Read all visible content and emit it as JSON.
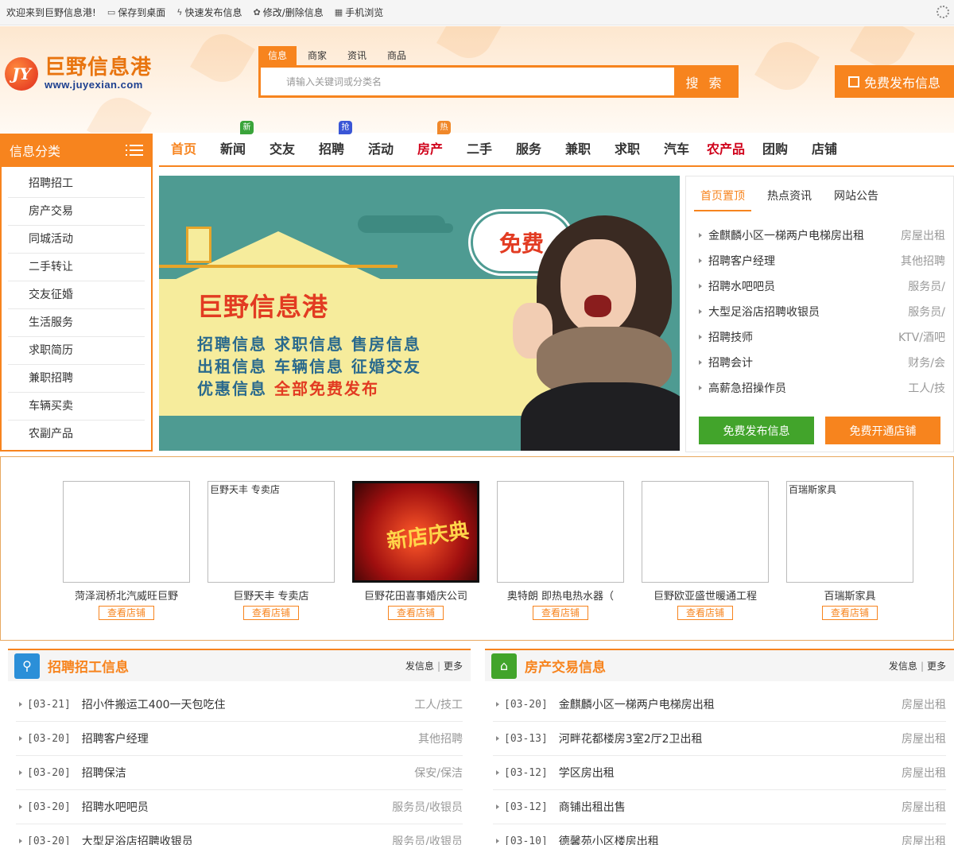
{
  "topbar": {
    "welcome": "欢迎来到巨野信息港!",
    "items": [
      {
        "label": "保存到桌面",
        "icon": "desktop-icon"
      },
      {
        "label": "快速发布信息",
        "icon": "lightning-icon"
      },
      {
        "label": "修改/删除信息",
        "icon": "gear-icon"
      },
      {
        "label": "手机浏览",
        "icon": "qrcode-icon"
      }
    ]
  },
  "logo": {
    "mark": "JY",
    "cn": "巨野信息港",
    "en": "www.juyexian.com"
  },
  "search": {
    "tabs": [
      "信息",
      "商家",
      "资讯",
      "商品"
    ],
    "active_tab": 0,
    "placeholder": "请输入关键词或分类名",
    "button": "搜 索"
  },
  "publish_button": "免费发布信息",
  "category": {
    "title": "信息分类",
    "items": [
      "招聘招工",
      "房产交易",
      "同城活动",
      "二手转让",
      "交友征婚",
      "生活服务",
      "求职简历",
      "兼职招聘",
      "车辆买卖",
      "农副产品"
    ]
  },
  "nav": {
    "items": [
      {
        "label": "首页",
        "style": "orange"
      },
      {
        "label": "新闻",
        "badge": "新",
        "badge_color": "#3aa43a"
      },
      {
        "label": "交友"
      },
      {
        "label": "招聘",
        "badge": "抢",
        "badge_color": "#3a56d6"
      },
      {
        "label": "活动"
      },
      {
        "label": "房产",
        "style": "red",
        "badge": "热",
        "badge_color": "#f0882a"
      },
      {
        "label": "二手"
      },
      {
        "label": "服务"
      },
      {
        "label": "兼职"
      },
      {
        "label": "求职"
      },
      {
        "label": "汽车"
      },
      {
        "label": "农产品",
        "style": "red"
      },
      {
        "label": "团购"
      },
      {
        "label": "店铺"
      }
    ]
  },
  "banner": {
    "bubble": "免费",
    "title": "巨野信息港",
    "line1": "招聘信息  求职信息  售房信息",
    "line2": "出租信息  车辆信息  征婚交友",
    "line3a": "优惠信息",
    "line3b": "全部免费发布"
  },
  "newsbox": {
    "tabs": [
      "首页置顶",
      "热点资讯",
      "网站公告"
    ],
    "active_tab": 0,
    "rows": [
      {
        "title": "金麒麟小区一梯两户电梯房出租",
        "cat": "房屋出租"
      },
      {
        "title": "招聘客户经理",
        "cat": "其他招聘"
      },
      {
        "title": "招聘水吧吧员",
        "cat": "服务员/"
      },
      {
        "title": "大型足浴店招聘收银员",
        "cat": "服务员/"
      },
      {
        "title": "招聘技师",
        "cat": "KTV/酒吧"
      },
      {
        "title": "招聘会计",
        "cat": "财务/会"
      },
      {
        "title": "高薪急招操作员",
        "cat": "工人/技"
      }
    ],
    "btn_green": "免费发布信息",
    "btn_orange": "免费开通店铺"
  },
  "shops": {
    "view_label": "查看店铺",
    "items": [
      {
        "name": "菏泽润桥北汽威旺巨野",
        "img_text": ""
      },
      {
        "name": "巨野天丰 专卖店",
        "img_text": "巨野天丰 专卖店"
      },
      {
        "name": "巨野花田喜事婚庆公司",
        "img_text": "",
        "festive": "新店庆典"
      },
      {
        "name": "奥特朗 即热电热水器（",
        "img_text": ""
      },
      {
        "name": "巨野欧亚盛世暖通工程",
        "img_text": ""
      },
      {
        "name": "百瑞斯家具",
        "img_text": "百瑞斯家具"
      }
    ]
  },
  "jobs": {
    "title": "招聘招工信息",
    "post": "发信息",
    "more": "更多",
    "icon_color": "#2b8fd8",
    "rows": [
      {
        "date": "[03-21]",
        "title": "招小件搬运工400一天包吃住",
        "cat": "工人/技工"
      },
      {
        "date": "[03-20]",
        "title": "招聘客户经理",
        "cat": "其他招聘"
      },
      {
        "date": "[03-20]",
        "title": "招聘保洁",
        "cat": "保安/保洁"
      },
      {
        "date": "[03-20]",
        "title": "招聘水吧吧员",
        "cat": "服务员/收银员"
      },
      {
        "date": "[03-20]",
        "title": "大型足浴店招聘收银员",
        "cat": "服务员/收银员"
      }
    ]
  },
  "house": {
    "title": "房产交易信息",
    "post": "发信息",
    "more": "更多",
    "icon_color": "#42a42b",
    "rows": [
      {
        "date": "[03-20]",
        "title": "金麒麟小区一梯两户电梯房出租",
        "cat": "房屋出租"
      },
      {
        "date": "[03-13]",
        "title": "河畔花都楼房3室2厅2卫出租",
        "cat": "房屋出租"
      },
      {
        "date": "[03-12]",
        "title": "学区房出租",
        "cat": "房屋出租"
      },
      {
        "date": "[03-12]",
        "title": "商铺出租出售",
        "cat": "房屋出租"
      },
      {
        "date": "[03-10]",
        "title": "德馨苑小区楼房出租",
        "cat": "房屋出租"
      }
    ]
  },
  "colors": {
    "accent": "#f7841e",
    "red": "#d0021b",
    "green": "#42a42b"
  }
}
